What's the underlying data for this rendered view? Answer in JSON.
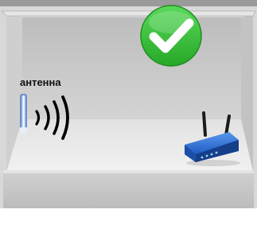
{
  "scene": {
    "antenna_label": "антенна",
    "status_icon": "checkmark-icon",
    "status_color": "#3cc83a",
    "router_icon": "wifi-router-icon",
    "router_color": "#2d6fd6",
    "signal_icon": "signal-waves-icon",
    "wall_color": "#c6c6c6",
    "floor_color": "#e9e9e9"
  }
}
